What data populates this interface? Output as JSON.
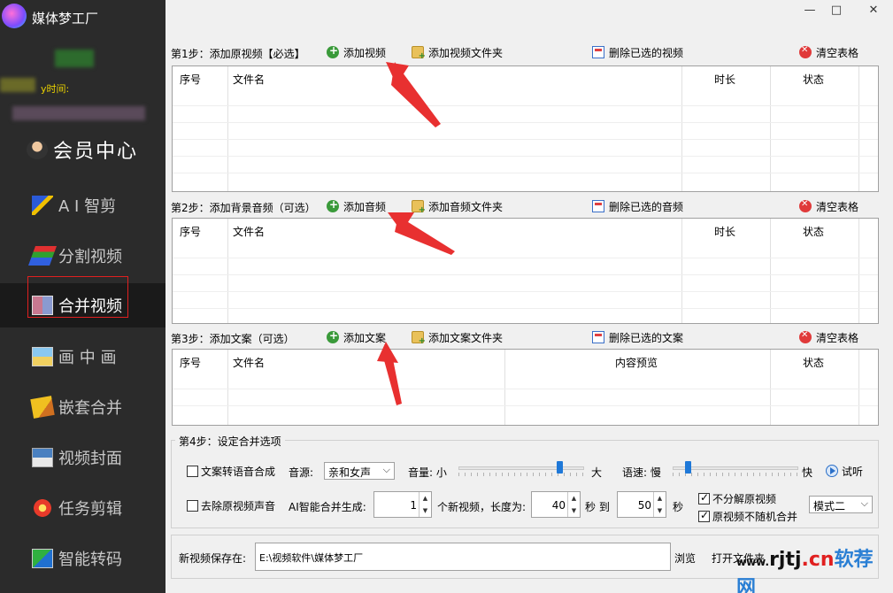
{
  "app": {
    "title": "媒体梦工厂",
    "expiry_label": "y时间:"
  },
  "window": {
    "minimize": "—",
    "maximize": "□",
    "close": "✕"
  },
  "sidebar": {
    "items": [
      {
        "label": "会员中心",
        "icon": "vip-user-icon"
      },
      {
        "label": "A I 智剪",
        "icon": "ai-wand-icon"
      },
      {
        "label": "分割视频",
        "icon": "split-layers-icon"
      },
      {
        "label": "合并视频",
        "icon": "merge-video-icon",
        "active": true
      },
      {
        "label": "画 中 画",
        "icon": "picture-icon"
      },
      {
        "label": "嵌套合并",
        "icon": "nest-tag-icon"
      },
      {
        "label": "视频封面",
        "icon": "cover-image-icon"
      },
      {
        "label": "任务剪辑",
        "icon": "flower-gear-icon"
      },
      {
        "label": "智能转码",
        "icon": "transcode-icon"
      }
    ]
  },
  "step1": {
    "label": "第1步：添加原视频【必选】",
    "add": "添加视频",
    "add_folder": "添加视频文件夹",
    "delete": "删除已选的视频",
    "clear": "清空表格",
    "columns": [
      "序号",
      "文件名",
      "时长",
      "状态"
    ]
  },
  "step2": {
    "label": "第2步：添加背景音频（可选）",
    "add": "添加音频",
    "add_folder": "添加音频文件夹",
    "delete": "删除已选的音频",
    "clear": "清空表格",
    "columns": [
      "序号",
      "文件名",
      "时长",
      "状态"
    ]
  },
  "step3": {
    "label": "第3步：添加文案（可选）",
    "add": "添加文案",
    "add_folder": "添加文案文件夹",
    "delete": "删除已选的文案",
    "clear": "清空表格",
    "columns": [
      "序号",
      "文件名",
      "内容预览",
      "状态"
    ]
  },
  "step4": {
    "label": "第4步：设定合并选项",
    "tts_label": "文案转语音合成",
    "tts_checked": false,
    "voice_label": "音源:",
    "voice_value": "亲和女声",
    "volume_label": "音量: 小",
    "volume_max": "大",
    "volume_level": 0.82,
    "speed_label": "语速: 慢",
    "speed_max": "快",
    "speed_level": 0.1,
    "listen_button": "试听",
    "remove_audio_label": "去除原视频声音",
    "remove_audio_checked": false,
    "ai_merge_label": "AI智能合并生成:",
    "count_value": "1",
    "count_unit": "个新视频，长度为:",
    "min_length": "40",
    "to_label": "秒 到",
    "max_length": "50",
    "sec_label": "秒",
    "no_split_label": "不分解原视频",
    "no_split_checked": true,
    "no_random_label": "原视频不随机合并",
    "no_random_checked": true,
    "mode_value": "模式二"
  },
  "save": {
    "label": "新视频保存在:",
    "path": "E:\\视频软件\\媒体梦工厂",
    "browse": "浏览",
    "open_folder": "打开文件夹"
  },
  "watermark": {
    "part1": "www.",
    "part2": "rjtj",
    "part3": ".cn",
    "part4": "软荐网"
  }
}
